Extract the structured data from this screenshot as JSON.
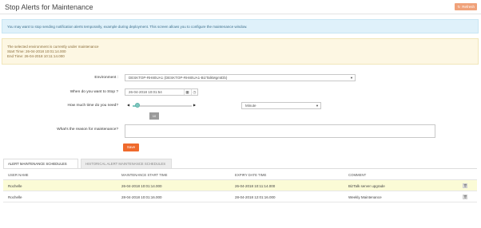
{
  "header": {
    "title": "Stop Alerts for Maintenance",
    "refresh_label": "Refresh",
    "refresh_icon": "↻"
  },
  "info": {
    "text": "You may want to stop sending notification alerts temporarily, example during deployment. This screen allows you to configure the maintenance window."
  },
  "maintenance_status": {
    "line1": "The selected environment is currently under maintenance",
    "line2": "Start Time: 26-04-2018 10:01:14.000",
    "line3": "End Time: 26-04-2018 10:11:14.000"
  },
  "form": {
    "environment_label": "Environment :",
    "environment_value": "DESKTOP-RH80UA1 (DESKTOP-RH80UA1-BizTalkMgmtDb)",
    "when_label": "When do you want to Stop ?",
    "when_value": "26-04-2018 10:01:54",
    "duration_label": "How much time do you need?",
    "duration_value": "10",
    "duration_level": 0.08,
    "unit_value": "Minute",
    "reason_label": "What's the reason for maintenance?",
    "reason_value": "",
    "save_label": "Save"
  },
  "tabs": {
    "active": "ALERT MAINTENANCE SCHEDULES",
    "inactive": "HISTORICAL ALERT MAINTENANCE SCHEDULES"
  },
  "table": {
    "headers": [
      "USER NAME",
      "MAINTENANCE START TIME",
      "EXPIRY DATE TIME",
      "COMMENT"
    ],
    "rows": [
      [
        "Rochelle",
        "26-04-2018 10:01:14.000",
        "26-04-2018 10:11:14.000",
        "BizTalk server upgrade"
      ],
      [
        "Rochelle",
        "28-04-2018 10:01:16.000",
        "28-04-2018 12:01:16.000",
        "Weekly Maintenance"
      ]
    ]
  },
  "colors": {
    "accent": "#ef6a2c",
    "info_bg": "#dff1fa",
    "warning_bg": "#fdf7e3",
    "highlight_row": "#fbfbd6"
  }
}
